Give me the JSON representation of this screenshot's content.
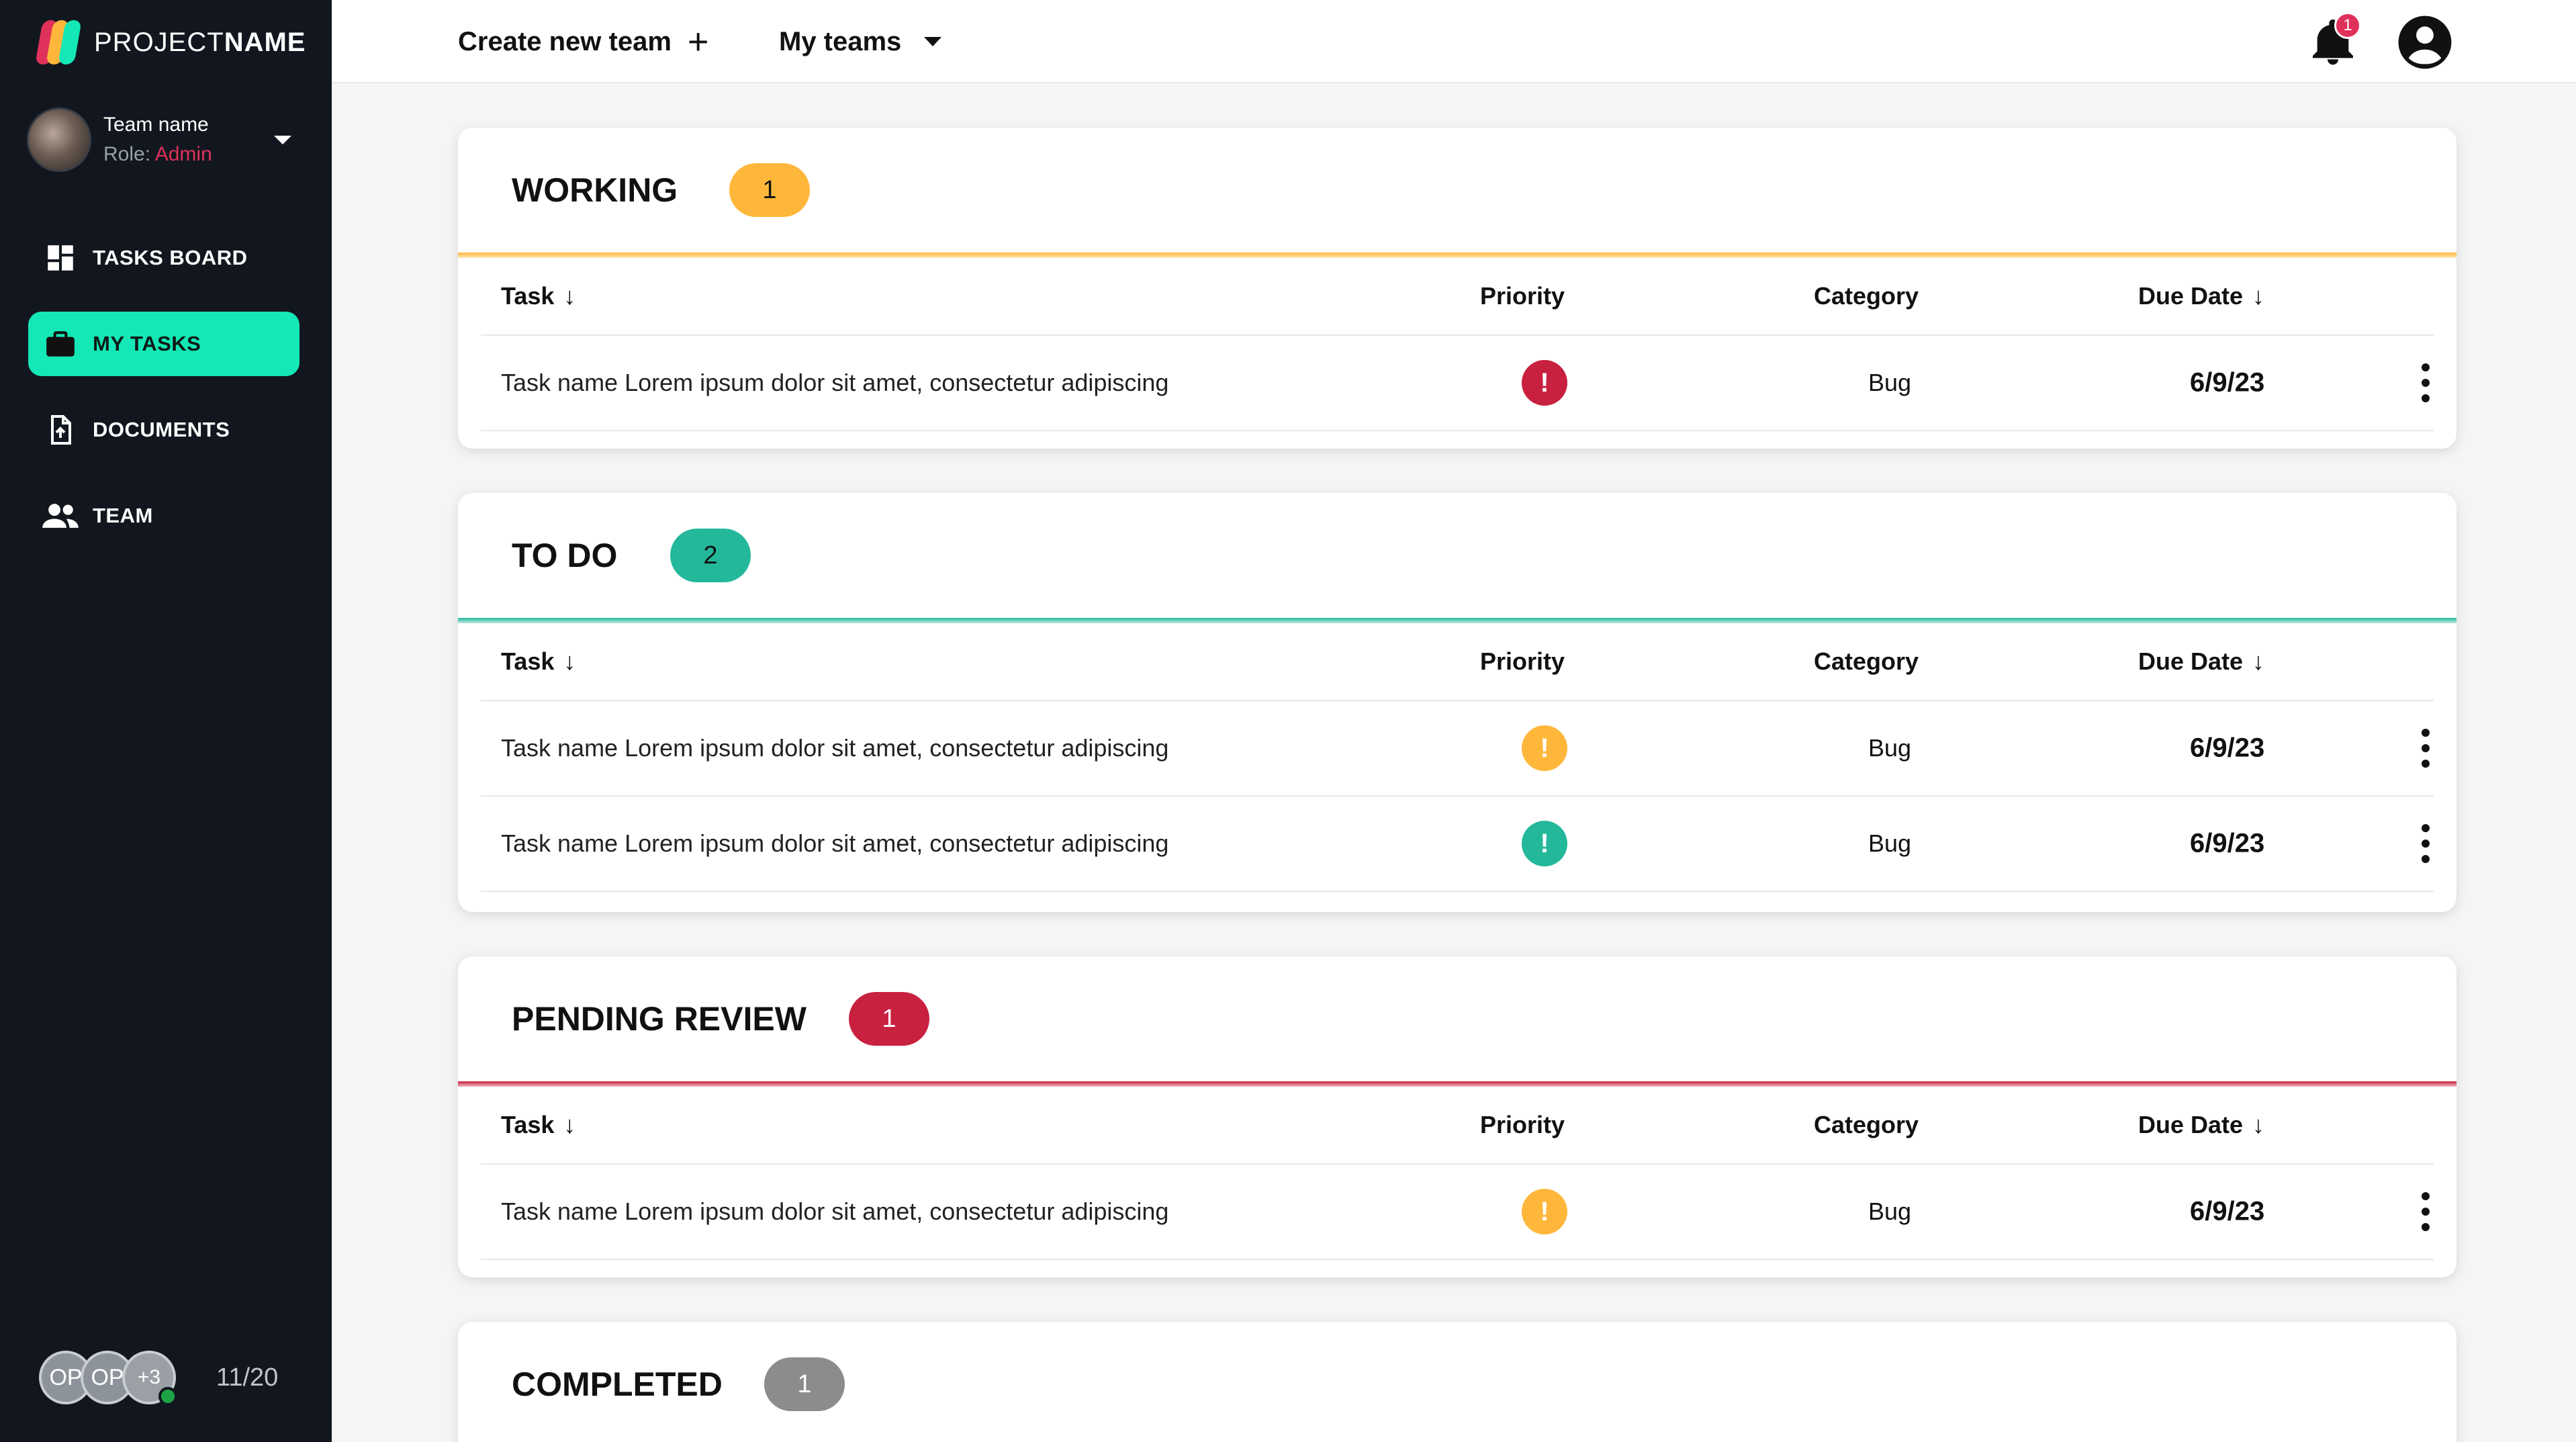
{
  "brand": {
    "prefix": "PROJECT",
    "suffix": "NAME"
  },
  "team": {
    "name": "Team name",
    "role_label": "Role: ",
    "role_value": "Admin"
  },
  "nav": [
    {
      "label": "TASKS BOARD",
      "icon": "dashboard-icon",
      "active": false
    },
    {
      "label": "MY TASKS",
      "icon": "briefcase-icon",
      "active": true
    },
    {
      "label": "DOCUMENTS",
      "icon": "document-upload-icon",
      "active": false
    },
    {
      "label": "TEAM",
      "icon": "group-icon",
      "active": false
    }
  ],
  "members": {
    "initials_1": "OP",
    "initials_2": "OP",
    "more": "+3",
    "count": "11/20"
  },
  "topbar": {
    "create_team": "Create new team",
    "create_glyph": "+",
    "my_teams": "My teams",
    "notification_count": "1"
  },
  "colors": {
    "accent": "#14e8b6",
    "working": "#ffb73b",
    "todo": "#24b89b",
    "pending": "#c8203f",
    "completed": "#8c8c8c"
  },
  "columns": {
    "task": "Task",
    "priority": "Priority",
    "category": "Category",
    "due": "Due Date",
    "sort_glyph": "↓"
  },
  "sections": [
    {
      "title": "WORKING",
      "count": "1",
      "color_key": "working",
      "rows": [
        {
          "task": "Task name Lorem ipsum dolor sit amet, consectetur adipiscing",
          "priority": "high",
          "category": "Bug",
          "due": "6/9/23"
        }
      ]
    },
    {
      "title": "TO DO",
      "count": "2",
      "color_key": "todo",
      "rows": [
        {
          "task": "Task name Lorem ipsum dolor sit amet, consectetur adipiscing",
          "priority": "medium",
          "category": "Bug",
          "due": "6/9/23"
        },
        {
          "task": "Task name Lorem ipsum dolor sit amet, consectetur adipiscing",
          "priority": "low",
          "category": "Bug",
          "due": "6/9/23"
        }
      ]
    },
    {
      "title": "PENDING REVIEW",
      "count": "1",
      "color_key": "pending",
      "rows": [
        {
          "task": "Task name Lorem ipsum dolor sit amet, consectetur adipiscing",
          "priority": "medium",
          "category": "Bug",
          "due": "6/9/23"
        }
      ]
    },
    {
      "title": "COMPLETED",
      "count": "1",
      "color_key": "completed",
      "rows": []
    }
  ],
  "priority_colors": {
    "high": "#c8203f",
    "medium": "#ffb73b",
    "low": "#24b89b"
  },
  "priority_glyph": "!"
}
